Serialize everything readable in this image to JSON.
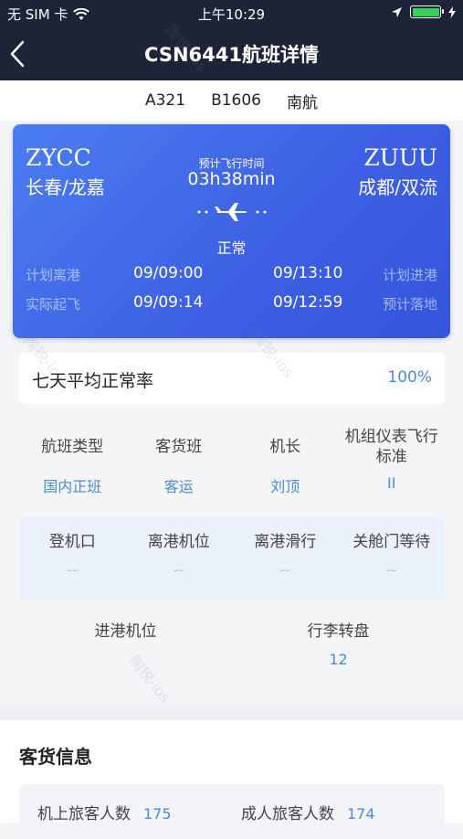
{
  "status_bar": {
    "carrier": "无 SIM 卡",
    "time": "上午10:29"
  },
  "nav": {
    "title": "CSN6441航班详情"
  },
  "aircraft": {
    "model": "A321",
    "registration": "B1606",
    "airline": "南航"
  },
  "flight": {
    "origin": {
      "code": "ZYCC",
      "city": "长春/龙嘉"
    },
    "destination": {
      "code": "ZUUU",
      "city": "成都/双流"
    },
    "duration_label": "预计飞行时间",
    "duration": "03h38min",
    "status": "正常",
    "planned_dep_label": "计划离港",
    "planned_dep": "09/09:00",
    "planned_arr": "09/13:10",
    "planned_arr_label": "计划进港",
    "actual_dep_label": "实际起飞",
    "actual_dep": "09/09:14",
    "est_arr": "09/12:59",
    "est_arr_label": "预计落地"
  },
  "on_time": {
    "label": "七天平均正常率",
    "value": "100%"
  },
  "info": [
    {
      "label": "航班类型",
      "value": "国内正班"
    },
    {
      "label": "客货班",
      "value": "客运"
    },
    {
      "label": "机长",
      "value": "刘顶"
    },
    {
      "label": "机组仪表飞行标准",
      "value": "II"
    }
  ],
  "gate": [
    {
      "label": "登机口",
      "value": "--"
    },
    {
      "label": "离港机位",
      "value": "--"
    },
    {
      "label": "离港滑行",
      "value": "--"
    },
    {
      "label": "关舱门等待",
      "value": "--"
    }
  ],
  "arrival": [
    {
      "label": "进港机位",
      "value": ""
    },
    {
      "label": "行李转盘",
      "value": "12"
    }
  ],
  "cargo": {
    "title": "客货信息",
    "pax_onboard_label": "机上旅客人数",
    "pax_onboard": "175",
    "adult_label": "成人旅客人数",
    "adult": "174"
  },
  "watermark": "陶锐-ios",
  "colors": {
    "nav_bg": "#1d2438",
    "card_blue": "#3d5fe3",
    "accent": "#4a8ad9",
    "battery": "#3ad15b"
  },
  "battery_level": 1.0
}
